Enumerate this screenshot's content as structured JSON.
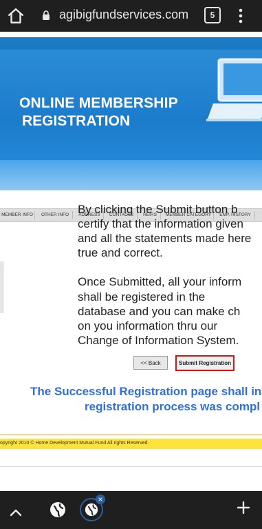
{
  "browser": {
    "url": "agibigfundservices.com",
    "tab_count": "5"
  },
  "banner": {
    "title_line1": "ONLINE MEMBERSHIP",
    "title_line2": "REGISTRATION"
  },
  "tabs": [
    {
      "label": "MEMBER INFO"
    },
    {
      "label": "OTHER INFO"
    },
    {
      "label": "ADDRESS"
    },
    {
      "label": "CONTACTS"
    },
    {
      "label": "HEIRS"
    },
    {
      "label": "MEMBER CATEGORY"
    },
    {
      "label": "EMP. HISTORY"
    }
  ],
  "content": {
    "para1": [
      "By clicking the Submit button b",
      "certify that the information given",
      "and all the statements made here",
      "true and correct."
    ],
    "para2": [
      "Once Submitted, all your inform",
      "shall  be  registered  in  the",
      "database and you can make ch",
      "on you information thru our",
      "Change of Information System."
    ]
  },
  "buttons": {
    "back_label": "<< Back",
    "submit_label": "Submit Registration"
  },
  "success": {
    "line1": "The Successful Registration page shall in",
    "line2": "registration process was compl"
  },
  "footer": {
    "text": "opyright 2010 © Home Development Mutual Fund All rights Reserved."
  },
  "colors": {
    "accent": "#2e6fd8",
    "banner_blue": "#1c7ccc",
    "highlight_red": "#d11111",
    "footer_yellow": "#ffe33a"
  }
}
